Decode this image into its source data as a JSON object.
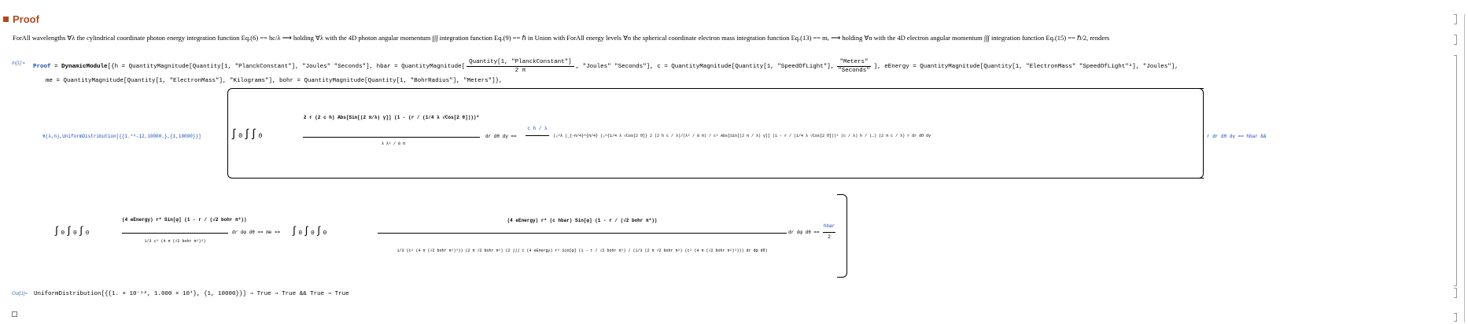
{
  "section": {
    "title": "Proof"
  },
  "text_cell": "ForAll wavelengths ∀λ the cylindrical coordinate photon energy integration function Eq.(6) == hc/λ ⟶ holding ∀λ with the 4D photon angular momentum ∫∫∫ integration function Eq.(9) == ℏ in Union with ForAll energy levels ∀n the spherical coordinate electron mass integration function Eq.(13) == mₑ ⟶ holding ∀n with the 4D electron angular momentum ∫∫∫ integration function Eq.(15) == ℏ/2, renders",
  "input": {
    "label": "In[1]:=",
    "assign_name": "Proof",
    "line1": {
      "dynamic": "DynamicModule",
      "h_def": "{h = QuantityMagnitude[Quantity[1, \"PlanckConstant\"], \"Joules\" \"Seconds\"], hbar = QuantityMagnitude[",
      "hbar_num": "Quantity[1, \"PlanckConstant\"]",
      "hbar_den": "2 π",
      "hbar_units": ", \"Joules\" \"Seconds\"], c = QuantityMagnitude[Quantity[1, \"SpeedOfLight\"],",
      "c_units_num": "\"Meters\"",
      "c_units_den": "\"Seconds\"",
      "eEnergy": "], eEnergy = QuantityMagnitude[Quantity[1, \"ElectronMass\" \"SpeedOfLight\"²], \"Joules\"],"
    },
    "line2": "me = QuantityMagnitude[Quantity[1, \"ElectronMass\"], \"Kilograms\"], bohr = QuantityMagnitude[Quantity[1, \"BohrRadius\"], \"Meters\"]},",
    "forall": "∀(λ,n),UniformDistribution[{{1.*^-12,10000.},{1,10000}}]",
    "photon_left_num": "2 r (2 c h) Abs[Sin[(2 π/λ) γ]] (1 - (r / (1/4 λ √Cos[2 θ])))²",
    "photon_left_den": "λ λ³ / 8 π",
    "photon_left_tail": "dr dθ dγ ==",
    "photon_mid": "c h / λ",
    "photon_right": "∫₀^λ ∫_{-π/4}^{π/4} ∫₀^{1/4 λ √Cos[2 θ]} 2 (2 h c / λ)/(λ³ / 8 π) / c² Abs[Sin[(2 π / λ) γ]] (1 - r / (1/4 λ √Cos[2 θ]))² (c / λ) h / (…) (2 π c / λ) r dr dθ dγ",
    "photon_end": "r dr dθ dγ == hbar &&",
    "electron_left_num": "(4 eEnergy) r² Sin[φ] (1 - r / (√2 bohr π²))",
    "electron_left_den": "1/3 c² (4 π (√2 bohr π²)³)",
    "electron_left_tail": "dr dφ dθ == me ==",
    "electron_right_num": "(4 eEnergy) r² (c hbar) Sin[φ] (1 - r / (√2 bohr π²))",
    "electron_right_den": "1/3 (c² (4 π (√2 bohr π²)³)) (2 π √2 bohr π²) (2 ∫∫∫ c (4 eEnergy) r² Sin[φ] (1 - r / √2 bohr π²) / (1/3 (2 π √2 bohr π²) (c² (4 π (√2 bohr π²)³))) dr dφ dθ)",
    "electron_tail": "dr dφ dθ ==",
    "electron_result_num": "hbar",
    "electron_result_den": "2"
  },
  "output": {
    "label": "Out[1]=",
    "text": "UniformDistribution[{{1. × 10⁻¹², 1.000 × 10⁴}, {1, 10000}}] ⇒ True ⇒ True && True ⇒ True"
  },
  "colors": {
    "title": "#b24a1c",
    "symbol": "#1a48b8",
    "label": "#4b6fa8"
  }
}
